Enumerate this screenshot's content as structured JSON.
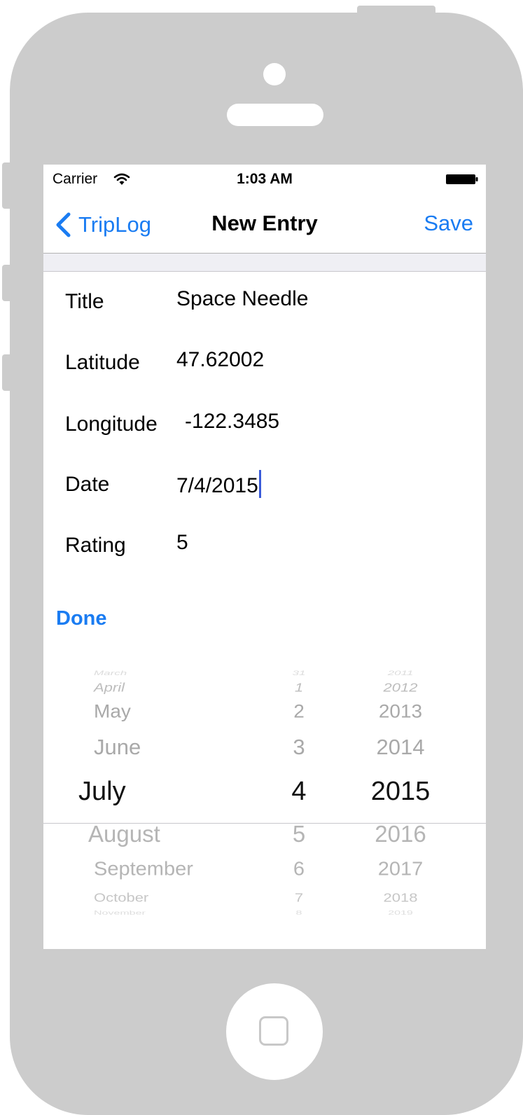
{
  "status_bar": {
    "carrier": "Carrier",
    "time": "1:03 AM"
  },
  "nav": {
    "back_label": "TripLog",
    "title": "New Entry",
    "save_label": "Save"
  },
  "form": {
    "title_label": "Title",
    "title_value": "Space Needle",
    "latitude_label": "Latitude",
    "latitude_value": "47.62002",
    "longitude_label": "Longitude",
    "longitude_value": "-122.3485",
    "date_label": "Date",
    "date_value": "7/4/2015",
    "rating_label": "Rating",
    "rating_value": "5"
  },
  "done_label": "Done",
  "picker": {
    "months": [
      "March",
      "April",
      "May",
      "June",
      "July",
      "August",
      "September",
      "October",
      "November"
    ],
    "days": [
      "31",
      "1",
      "2",
      "3",
      "4",
      "5",
      "6",
      "7",
      "8"
    ],
    "years": [
      "2011",
      "2012",
      "2013",
      "2014",
      "2015",
      "2016",
      "2017",
      "2018",
      "2019"
    ],
    "selected_month": "July",
    "selected_day": "4",
    "selected_year": "2015"
  },
  "colors": {
    "accent": "#1a7cf2",
    "frame": "#cccccc"
  }
}
